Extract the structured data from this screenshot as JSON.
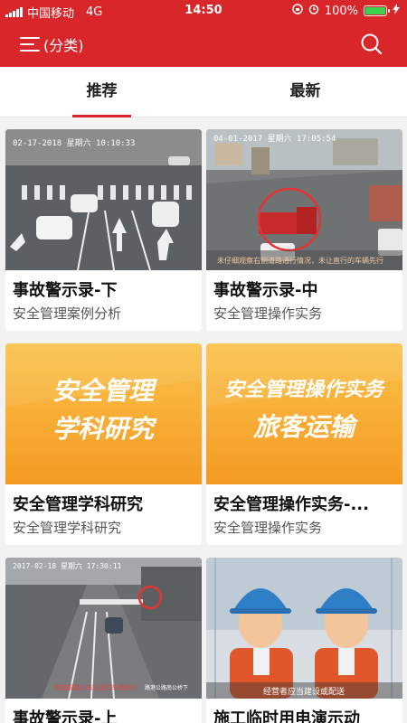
{
  "status_bar": {
    "carrier": "中国移动",
    "network": "4G",
    "time": "14:50",
    "battery": "100%"
  },
  "header": {
    "menu_label": "(分类)",
    "menu_icon": "menu-icon",
    "search_icon": "search-icon"
  },
  "tabs": [
    {
      "label": "推荐",
      "active": true
    },
    {
      "label": "最新",
      "active": false
    }
  ],
  "cards": [
    {
      "title": "事故警示录-下",
      "subtitle": "安全管理案例分析",
      "thumb_stamp": "02-17-2018 星期六 10:10:33"
    },
    {
      "title": "事故警示录-中",
      "subtitle": "安全管理操作实务",
      "thumb_stamp": "04-01-2017 星期六 17:05:54",
      "thumb_caption": "未仔细观察右侧道路通行情况，未让直行的车辆先行"
    },
    {
      "title": "安全管理学科研究",
      "subtitle": "安全管理学科研究",
      "cover_line1": "安全管理",
      "cover_line2": "学科研究"
    },
    {
      "title": "安全管理操作实务-...",
      "subtitle": "安全管理操作实务",
      "cover_line1": "安全管理操作实务",
      "cover_line2": "旅客运输"
    },
    {
      "title": "事故警示录-上",
      "subtitle": "",
      "thumb_stamp": "2017-02-18 星期六 17:30:11",
      "thumb_caption": "在前部路口未让直行车辆先行",
      "thumb_caption2": "路港公路南公桥下"
    },
    {
      "title": "施工临时用电演示动",
      "subtitle": "",
      "thumb_caption": "经营者应当建设或配送"
    }
  ],
  "colors": {
    "brand_red": "#d9262b",
    "cover_orange": "#f7b030",
    "battery_green": "#3ad14b"
  }
}
